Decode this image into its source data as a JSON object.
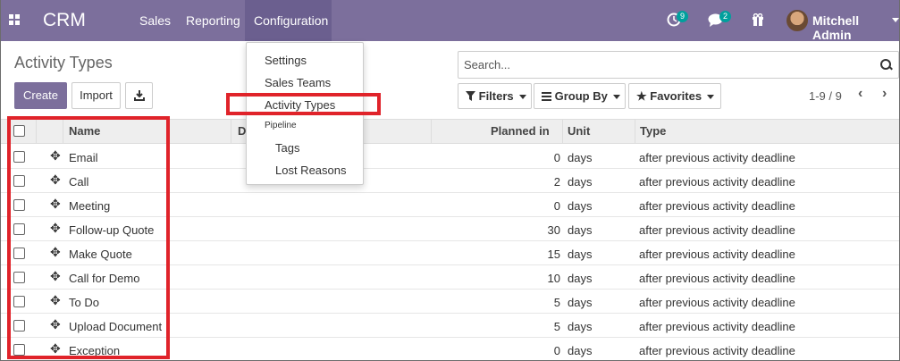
{
  "navbar": {
    "brand": "CRM",
    "menus": [
      "Sales",
      "Reporting",
      "Configuration"
    ],
    "activity_count": "9",
    "message_count": "2",
    "user_name": "Mitchell Admin"
  },
  "control_panel": {
    "title": "Activity Types",
    "create_label": "Create",
    "import_label": "Import",
    "search_placeholder": "Search...",
    "filters_label": "Filters",
    "group_by_label": "Group By",
    "favorites_label": "Favorites",
    "pager": "1-9 / 9"
  },
  "dropdown": {
    "items": [
      "Settings",
      "Sales Teams",
      "Activity Types"
    ],
    "section_header": "Pipeline",
    "pipeline_items": [
      "Tags",
      "Lost Reasons"
    ]
  },
  "table": {
    "columns": [
      "Name",
      "D",
      "Planned in",
      "Unit",
      "Type"
    ],
    "rows": [
      {
        "name": "Email",
        "planned": "0",
        "unit": "days",
        "type": "after previous activity deadline"
      },
      {
        "name": "Call",
        "planned": "2",
        "unit": "days",
        "type": "after previous activity deadline"
      },
      {
        "name": "Meeting",
        "planned": "0",
        "unit": "days",
        "type": "after previous activity deadline"
      },
      {
        "name": "Follow-up Quote",
        "planned": "30",
        "unit": "days",
        "type": "after previous activity deadline"
      },
      {
        "name": "Make Quote",
        "planned": "15",
        "unit": "days",
        "type": "after previous activity deadline"
      },
      {
        "name": "Call for Demo",
        "planned": "10",
        "unit": "days",
        "type": "after previous activity deadline"
      },
      {
        "name": "To Do",
        "planned": "5",
        "unit": "days",
        "type": "after previous activity deadline"
      },
      {
        "name": "Upload Document",
        "planned": "5",
        "unit": "days",
        "type": "after previous activity deadline"
      },
      {
        "name": "Exception",
        "planned": "0",
        "unit": "days",
        "type": "after previous activity deadline"
      }
    ]
  },
  "colors": {
    "brand": "#7c6f9c",
    "highlight": "#e0232a",
    "badge": "#00a09d"
  }
}
